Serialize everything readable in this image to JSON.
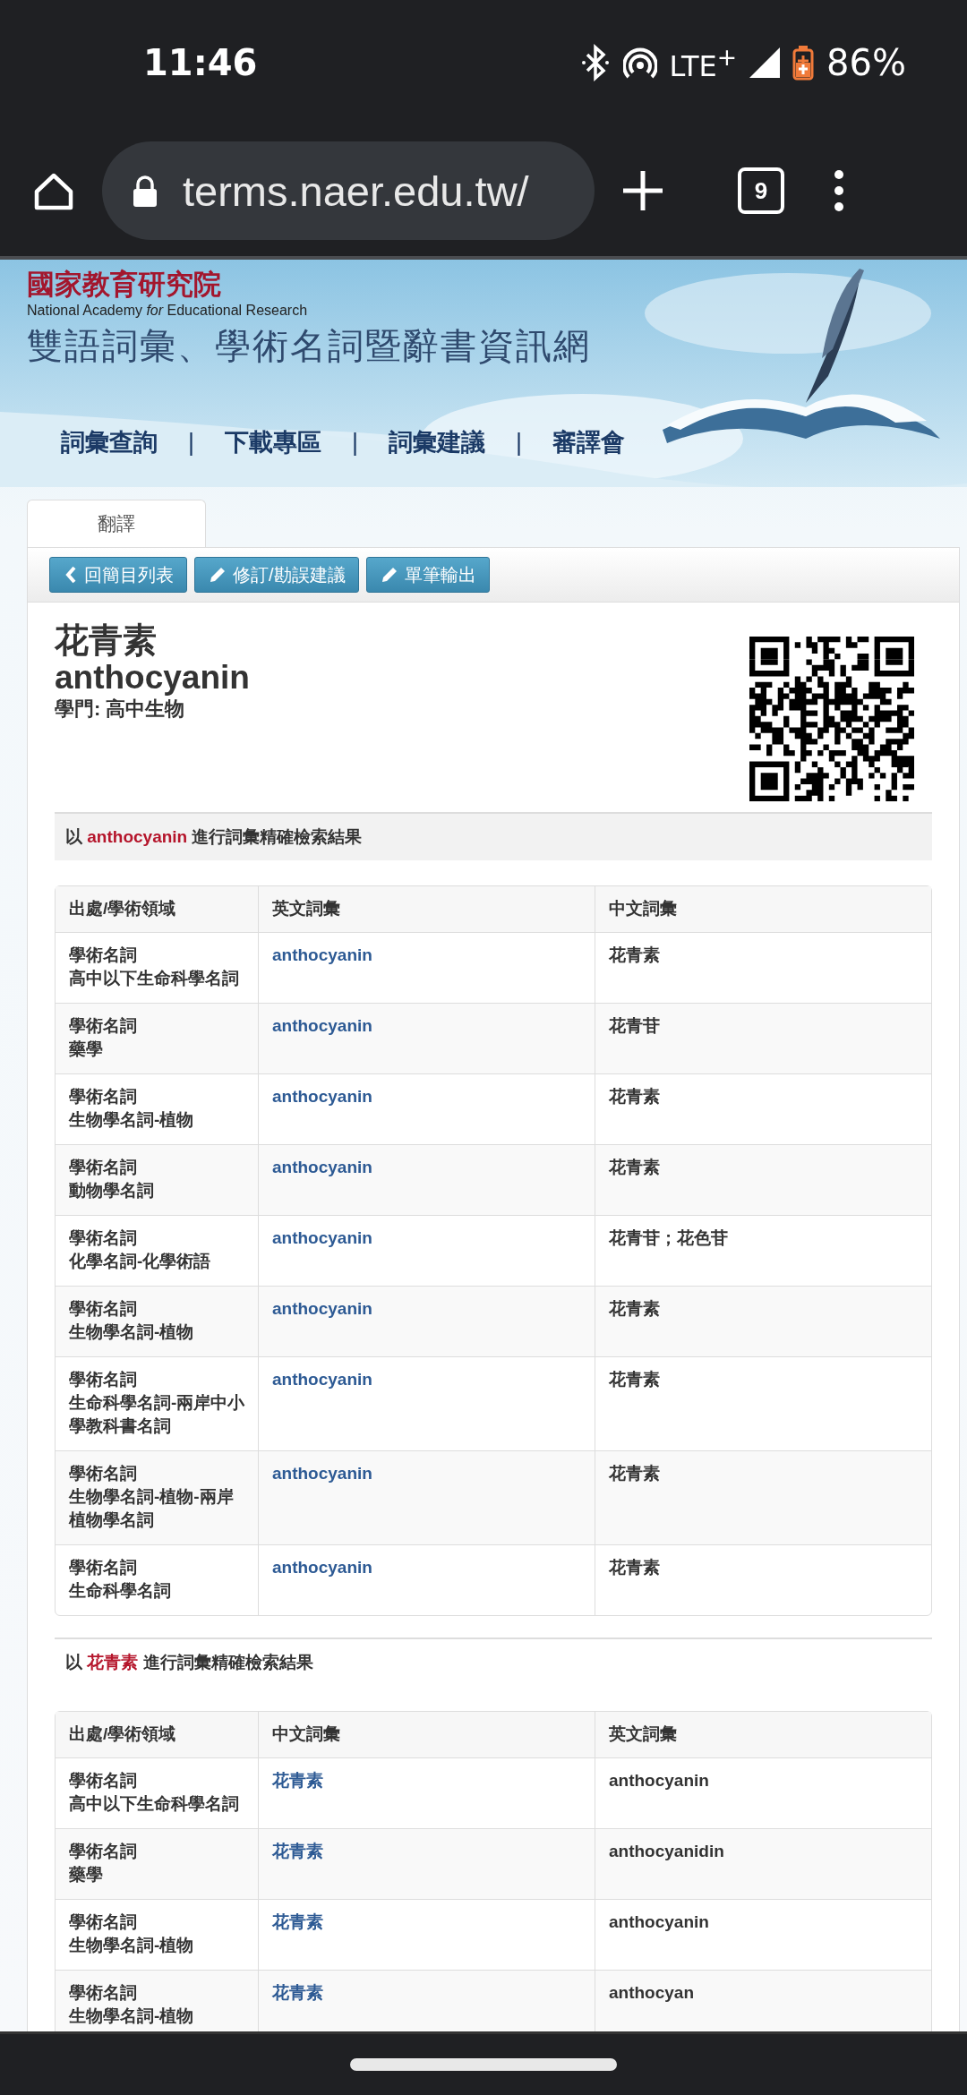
{
  "status_bar": {
    "time": "11:46",
    "network": "LTE$^{+}$",
    "battery": "86%"
  },
  "browser": {
    "url": "terms.naer.edu.tw/",
    "tab_count": "9"
  },
  "banner": {
    "org_name": "國家教育研究院",
    "org_name_en": "National Academy *for* Educational Research",
    "site_title": "雙語詞彙、學術名詞暨辭書資訊網"
  },
  "nav": [
    {
      "kind": "link",
      "label": "詞彙查詢"
    },
    {
      "kind": "separator",
      "label": "|"
    },
    {
      "kind": "link",
      "label": "下載專區"
    },
    {
      "kind": "separator",
      "label": "|"
    },
    {
      "kind": "link",
      "label": "詞彙建議"
    },
    {
      "kind": "separator",
      "label": "|"
    },
    {
      "kind": "link",
      "label": "審譯會"
    }
  ],
  "tabs": [
    {
      "label": "翻譯",
      "selected": true
    }
  ],
  "toolbar": [
    {
      "kind": "back",
      "label": "回簡目列表"
    },
    {
      "kind": "pencil",
      "label": "修訂/勘誤建議"
    },
    {
      "kind": "pencil",
      "label": "單筆輸出"
    }
  ],
  "term": {
    "zh": "花青素",
    "en": "anthocyanin",
    "field": "學門: 高中生物"
  },
  "sections": [
    {
      "caption": "以 **anthocyanin** 進行詞彙精確檢索結果",
      "shaded": true,
      "columns": [
        "出處/學術領域",
        "英文詞彙",
        "中文詞彙"
      ],
      "rows": [
        {
          "source": "學術名詞",
          "field": "高中以下生命科學名詞",
          "link_term": "anthocyanin",
          "other_term": "花青素"
        },
        {
          "source": "學術名詞",
          "field": "藥學",
          "link_term": "anthocyanin",
          "other_term": "花青苷"
        },
        {
          "source": "學術名詞",
          "field": "生物學名詞-植物",
          "link_term": "anthocyanin",
          "other_term": "花青素"
        },
        {
          "source": "學術名詞",
          "field": "動物學名詞",
          "link_term": "anthocyanin",
          "other_term": "花青素"
        },
        {
          "source": "學術名詞",
          "field": "化學名詞-化學術語",
          "link_term": "anthocyanin",
          "other_term": "花青苷；花色苷"
        },
        {
          "source": "學術名詞",
          "field": "生物學名詞-植物",
          "link_term": "anthocyanin",
          "other_term": "花青素"
        },
        {
          "source": "學術名詞",
          "field": "生命科學名詞-兩岸中小學教科書名詞",
          "link_term": "anthocyanin",
          "other_term": "花青素"
        },
        {
          "source": "學術名詞",
          "field": "生物學名詞-植物-兩岸植物學名詞",
          "link_term": "anthocyanin",
          "other_term": "花青素"
        },
        {
          "source": "學術名詞",
          "field": "生命科學名詞",
          "link_term": "anthocyanin",
          "other_term": "花青素"
        }
      ]
    },
    {
      "caption": "以 **花青素** 進行詞彙精確檢索結果",
      "shaded": false,
      "columns": [
        "出處/學術領域",
        "中文詞彙",
        "英文詞彙"
      ],
      "rows": [
        {
          "source": "學術名詞",
          "field": "高中以下生命科學名詞",
          "link_term": "花青素",
          "other_term": "anthocyanin"
        },
        {
          "source": "學術名詞",
          "field": "藥學",
          "link_term": "花青素",
          "other_term": "anthocyanidin"
        },
        {
          "source": "學術名詞",
          "field": "生物學名詞-植物",
          "link_term": "花青素",
          "other_term": "anthocyanin"
        },
        {
          "source": "學術名詞",
          "field": "生物學名詞-植物",
          "link_term": "花青素",
          "other_term": "anthocyan"
        }
      ]
    }
  ]
}
